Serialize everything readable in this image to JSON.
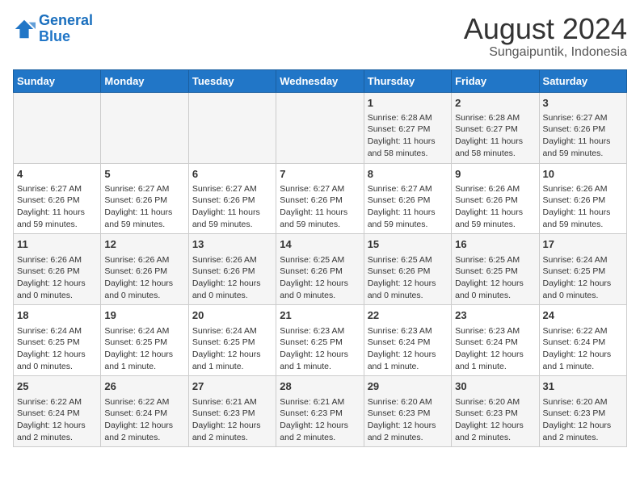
{
  "logo": {
    "line1": "General",
    "line2": "Blue"
  },
  "title": "August 2024",
  "subtitle": "Sungaipuntik, Indonesia",
  "days_of_week": [
    "Sunday",
    "Monday",
    "Tuesday",
    "Wednesday",
    "Thursday",
    "Friday",
    "Saturday"
  ],
  "weeks": [
    [
      {
        "day": "",
        "info": ""
      },
      {
        "day": "",
        "info": ""
      },
      {
        "day": "",
        "info": ""
      },
      {
        "day": "",
        "info": ""
      },
      {
        "day": "1",
        "info": "Sunrise: 6:28 AM\nSunset: 6:27 PM\nDaylight: 11 hours and 58 minutes."
      },
      {
        "day": "2",
        "info": "Sunrise: 6:28 AM\nSunset: 6:27 PM\nDaylight: 11 hours and 58 minutes."
      },
      {
        "day": "3",
        "info": "Sunrise: 6:27 AM\nSunset: 6:26 PM\nDaylight: 11 hours and 59 minutes."
      }
    ],
    [
      {
        "day": "4",
        "info": "Sunrise: 6:27 AM\nSunset: 6:26 PM\nDaylight: 11 hours and 59 minutes."
      },
      {
        "day": "5",
        "info": "Sunrise: 6:27 AM\nSunset: 6:26 PM\nDaylight: 11 hours and 59 minutes."
      },
      {
        "day": "6",
        "info": "Sunrise: 6:27 AM\nSunset: 6:26 PM\nDaylight: 11 hours and 59 minutes."
      },
      {
        "day": "7",
        "info": "Sunrise: 6:27 AM\nSunset: 6:26 PM\nDaylight: 11 hours and 59 minutes."
      },
      {
        "day": "8",
        "info": "Sunrise: 6:27 AM\nSunset: 6:26 PM\nDaylight: 11 hours and 59 minutes."
      },
      {
        "day": "9",
        "info": "Sunrise: 6:26 AM\nSunset: 6:26 PM\nDaylight: 11 hours and 59 minutes."
      },
      {
        "day": "10",
        "info": "Sunrise: 6:26 AM\nSunset: 6:26 PM\nDaylight: 11 hours and 59 minutes."
      }
    ],
    [
      {
        "day": "11",
        "info": "Sunrise: 6:26 AM\nSunset: 6:26 PM\nDaylight: 12 hours and 0 minutes."
      },
      {
        "day": "12",
        "info": "Sunrise: 6:26 AM\nSunset: 6:26 PM\nDaylight: 12 hours and 0 minutes."
      },
      {
        "day": "13",
        "info": "Sunrise: 6:26 AM\nSunset: 6:26 PM\nDaylight: 12 hours and 0 minutes."
      },
      {
        "day": "14",
        "info": "Sunrise: 6:25 AM\nSunset: 6:26 PM\nDaylight: 12 hours and 0 minutes."
      },
      {
        "day": "15",
        "info": "Sunrise: 6:25 AM\nSunset: 6:26 PM\nDaylight: 12 hours and 0 minutes."
      },
      {
        "day": "16",
        "info": "Sunrise: 6:25 AM\nSunset: 6:25 PM\nDaylight: 12 hours and 0 minutes."
      },
      {
        "day": "17",
        "info": "Sunrise: 6:24 AM\nSunset: 6:25 PM\nDaylight: 12 hours and 0 minutes."
      }
    ],
    [
      {
        "day": "18",
        "info": "Sunrise: 6:24 AM\nSunset: 6:25 PM\nDaylight: 12 hours and 0 minutes."
      },
      {
        "day": "19",
        "info": "Sunrise: 6:24 AM\nSunset: 6:25 PM\nDaylight: 12 hours and 1 minute."
      },
      {
        "day": "20",
        "info": "Sunrise: 6:24 AM\nSunset: 6:25 PM\nDaylight: 12 hours and 1 minute."
      },
      {
        "day": "21",
        "info": "Sunrise: 6:23 AM\nSunset: 6:25 PM\nDaylight: 12 hours and 1 minute."
      },
      {
        "day": "22",
        "info": "Sunrise: 6:23 AM\nSunset: 6:24 PM\nDaylight: 12 hours and 1 minute."
      },
      {
        "day": "23",
        "info": "Sunrise: 6:23 AM\nSunset: 6:24 PM\nDaylight: 12 hours and 1 minute."
      },
      {
        "day": "24",
        "info": "Sunrise: 6:22 AM\nSunset: 6:24 PM\nDaylight: 12 hours and 1 minute."
      }
    ],
    [
      {
        "day": "25",
        "info": "Sunrise: 6:22 AM\nSunset: 6:24 PM\nDaylight: 12 hours and 2 minutes."
      },
      {
        "day": "26",
        "info": "Sunrise: 6:22 AM\nSunset: 6:24 PM\nDaylight: 12 hours and 2 minutes."
      },
      {
        "day": "27",
        "info": "Sunrise: 6:21 AM\nSunset: 6:23 PM\nDaylight: 12 hours and 2 minutes."
      },
      {
        "day": "28",
        "info": "Sunrise: 6:21 AM\nSunset: 6:23 PM\nDaylight: 12 hours and 2 minutes."
      },
      {
        "day": "29",
        "info": "Sunrise: 6:20 AM\nSunset: 6:23 PM\nDaylight: 12 hours and 2 minutes."
      },
      {
        "day": "30",
        "info": "Sunrise: 6:20 AM\nSunset: 6:23 PM\nDaylight: 12 hours and 2 minutes."
      },
      {
        "day": "31",
        "info": "Sunrise: 6:20 AM\nSunset: 6:23 PM\nDaylight: 12 hours and 2 minutes."
      }
    ]
  ]
}
